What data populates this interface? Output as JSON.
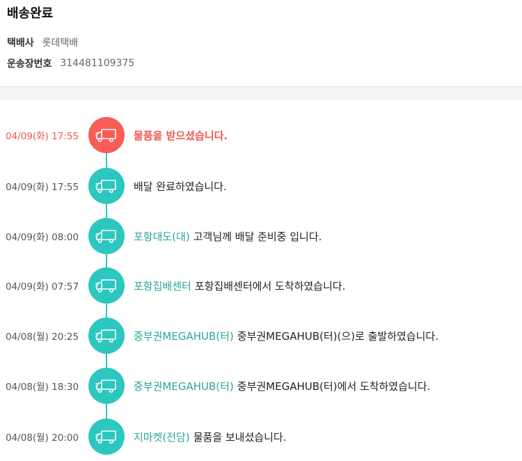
{
  "header": {
    "status": "배송완료",
    "carrier_label": "택배사",
    "carrier_value": "롯데택배",
    "tracking_label": "운송장번호",
    "tracking_value": "314481109375"
  },
  "timeline": [
    {
      "time": "04/09(화) 17:55",
      "location": "",
      "message": "물품을 받으셨습니다.",
      "current": true,
      "icon": "truck-icon"
    },
    {
      "time": "04/09(화) 17:55",
      "location": "",
      "message": "배달 완료하였습니다.",
      "current": false,
      "icon": "truck-icon"
    },
    {
      "time": "04/09(화) 08:00",
      "location": "포항대도(대)",
      "message": "고객님께 배달 준비중 입니다.",
      "current": false,
      "icon": "truck-icon"
    },
    {
      "time": "04/09(화) 07:57",
      "location": "포항집배센터",
      "message": "포항집배센터에서 도착하였습니다.",
      "current": false,
      "icon": "truck-icon"
    },
    {
      "time": "04/08(월) 20:25",
      "location": "중부권MEGAHUB(터)",
      "message": "중부권MEGAHUB(터)(으)로 출발하였습니다.",
      "current": false,
      "icon": "truck-icon"
    },
    {
      "time": "04/08(월) 18:30",
      "location": "중부권MEGAHUB(터)",
      "message": "중부권MEGAHUB(터)에서 도착하였습니다.",
      "current": false,
      "icon": "truck-icon"
    },
    {
      "time": "04/08(월) 20:00",
      "location": "지마켓(전담)",
      "message": "물품을 보내셨습니다.",
      "current": false,
      "icon": "truck-icon"
    }
  ],
  "colors": {
    "accent_teal": "#2cc7bf",
    "location_teal": "#2aa39b",
    "current_red": "#f75c57"
  }
}
